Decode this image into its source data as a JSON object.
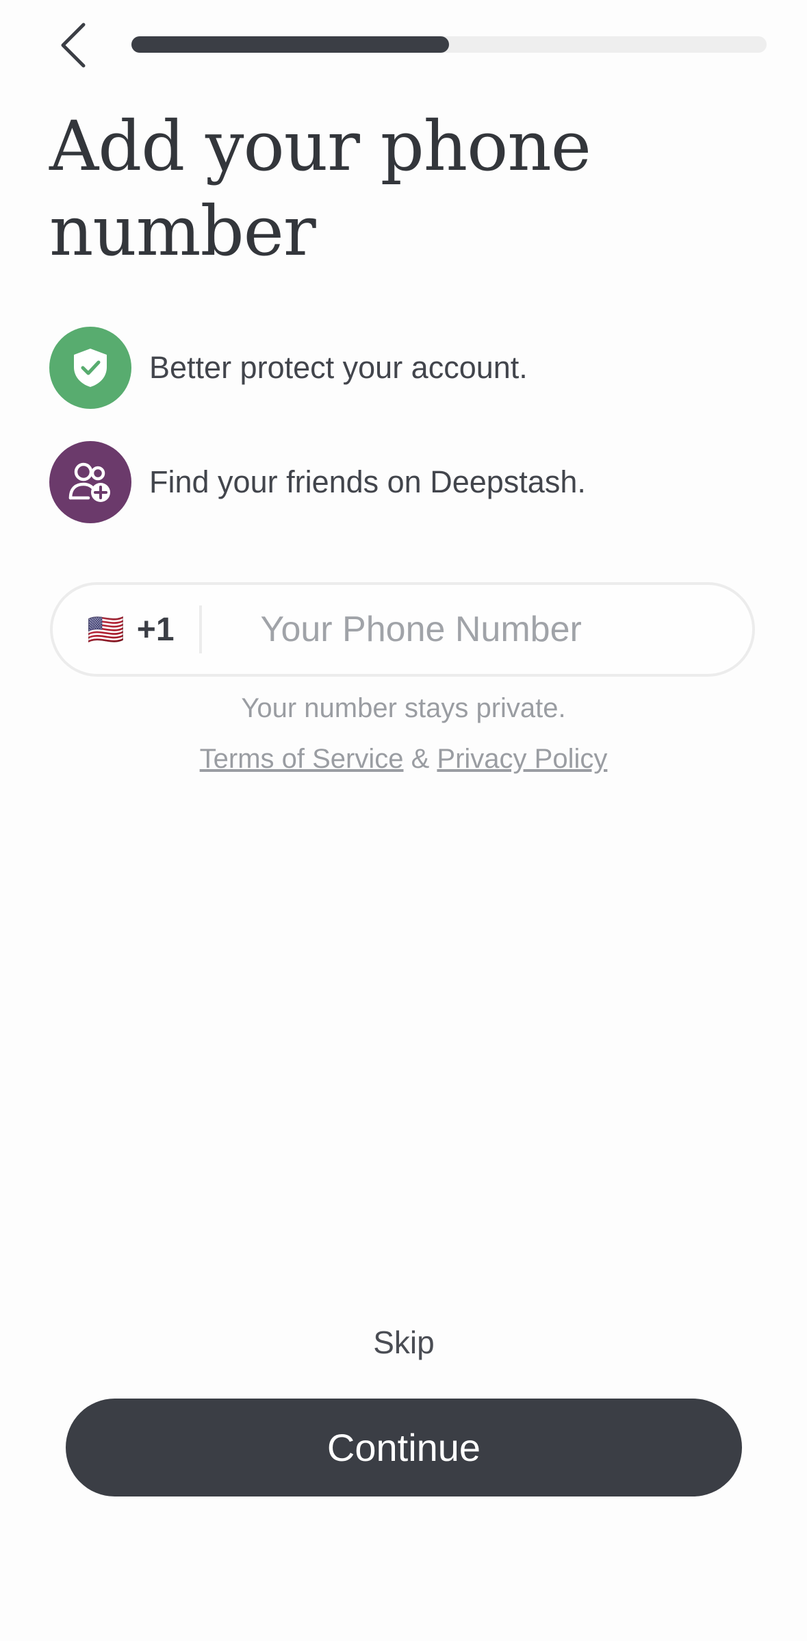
{
  "header": {
    "back_icon": "chevron-left-icon",
    "progress_value": 0.5
  },
  "title": "Add your phone number",
  "features": [
    {
      "icon": "shield-check-icon",
      "color": "#58ac6f",
      "label": "Better protect your account."
    },
    {
      "icon": "users-add-icon",
      "color": "#6b3a6b",
      "label": "Find your friends on Deepstash."
    }
  ],
  "phone": {
    "flag": "🇺🇸",
    "dial_code": "+1",
    "placeholder": "Your Phone Number",
    "value": ""
  },
  "privacy_note": "Your number stays private.",
  "legal": {
    "terms": "Terms of Service",
    "separator": " & ",
    "privacy": "Privacy Policy"
  },
  "actions": {
    "skip": "Skip",
    "continue": "Continue"
  },
  "colors": {
    "primary_dark": "#3b3e45",
    "green": "#58ac6f",
    "purple": "#6b3a6b"
  }
}
